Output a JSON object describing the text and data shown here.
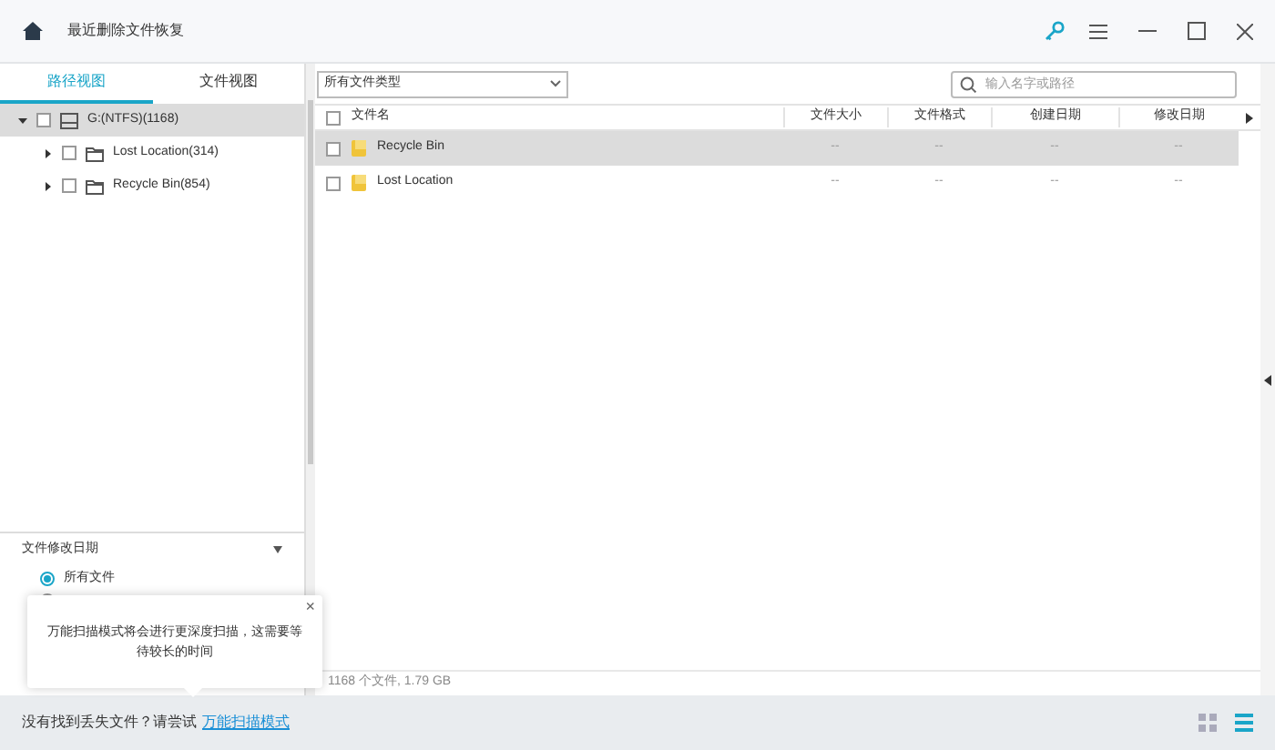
{
  "window": {
    "title": "最近删除文件恢复"
  },
  "tabs": [
    {
      "label": "路径视图",
      "selected": true
    },
    {
      "label": "文件视图",
      "selected": false
    }
  ],
  "filter": {
    "value": "所有文件类型"
  },
  "search": {
    "placeholder": "输入名字或路径"
  },
  "tree": [
    {
      "label": "G:(NTFS)(1168)",
      "kind": "drive",
      "expanded": true,
      "selected": true,
      "checked": false,
      "children": [
        {
          "label": "Lost Location(314)",
          "kind": "folder",
          "expanded": false,
          "selected": false,
          "checked": false
        },
        {
          "label": "Recycle Bin(854)",
          "kind": "folder",
          "expanded": false,
          "selected": false,
          "checked": false
        }
      ]
    }
  ],
  "table": {
    "all_checked": false,
    "columns": [
      "文件名",
      "文件大小",
      "文件格式",
      "创建日期",
      "修改日期"
    ],
    "rows": [
      {
        "cells": [
          "Recycle Bin",
          "--",
          "--",
          "--",
          "--"
        ],
        "selected": true,
        "checked": false
      },
      {
        "cells": [
          "Lost Location",
          "--",
          "--",
          "--",
          "--"
        ],
        "selected": false,
        "checked": false
      }
    ]
  },
  "date_filter": {
    "title": "文件修改日期",
    "options": [
      {
        "label": "所有文件",
        "selected": true
      },
      {
        "selected": false
      }
    ]
  },
  "tooltip": {
    "text": "万能扫描模式将会进行更深度扫描，这需要等待较长的时间",
    "close": "×"
  },
  "file_count": "1168 个文件, 1.79 GB",
  "bottom": {
    "text": "没有找到丢失文件？请尝试",
    "link": "万能扫描模式"
  },
  "views": [
    {
      "kind": "grid",
      "selected": false
    },
    {
      "kind": "list",
      "selected": true
    }
  ]
}
